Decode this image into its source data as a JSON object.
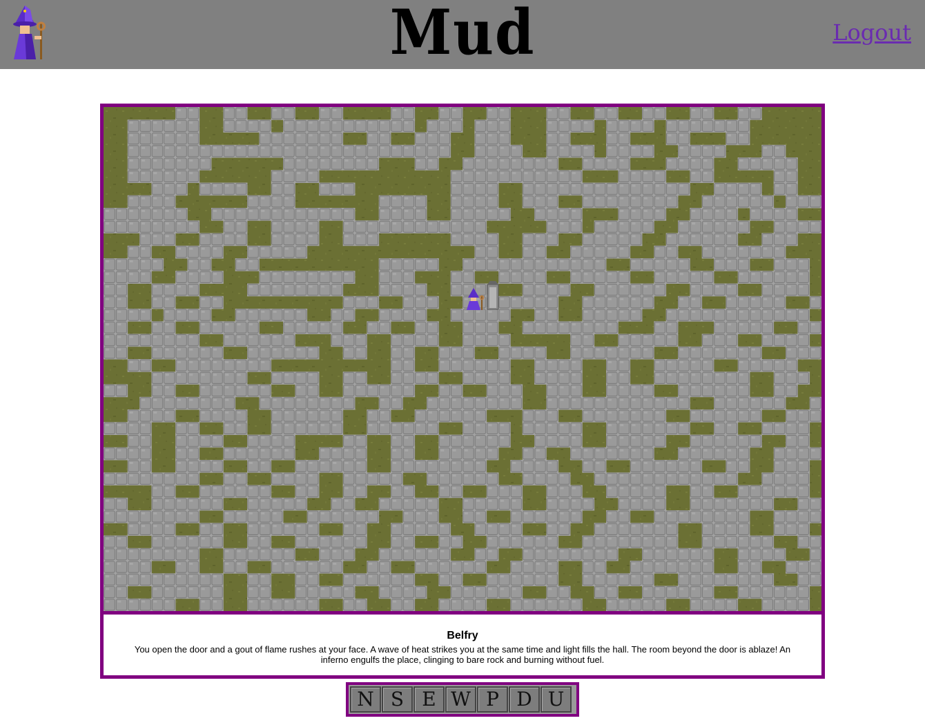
{
  "header": {
    "title": "Mud",
    "logout_label": "Logout",
    "avatar_icon": "wizard-icon"
  },
  "map": {
    "floor_texture": "cobblestone",
    "wall_texture": "grass",
    "player_icon": "wizard-icon",
    "door_icon": "door-icon",
    "colors": {
      "border": "#800080",
      "grass": "#6b7034",
      "stone": "#9a9a9a"
    }
  },
  "room": {
    "name": "Belfry",
    "description": "You open the door and a gout of flame rushes at your face. A wave of heat strikes you at the same time and light fills the hall. The room beyond the door is ablaze! An inferno engulfs the place, clinging to bare rock and burning without fuel."
  },
  "controls": {
    "buttons": [
      {
        "label": "N"
      },
      {
        "label": "S"
      },
      {
        "label": "E"
      },
      {
        "label": "W"
      },
      {
        "label": "P"
      },
      {
        "label": "D"
      },
      {
        "label": "U"
      }
    ]
  }
}
